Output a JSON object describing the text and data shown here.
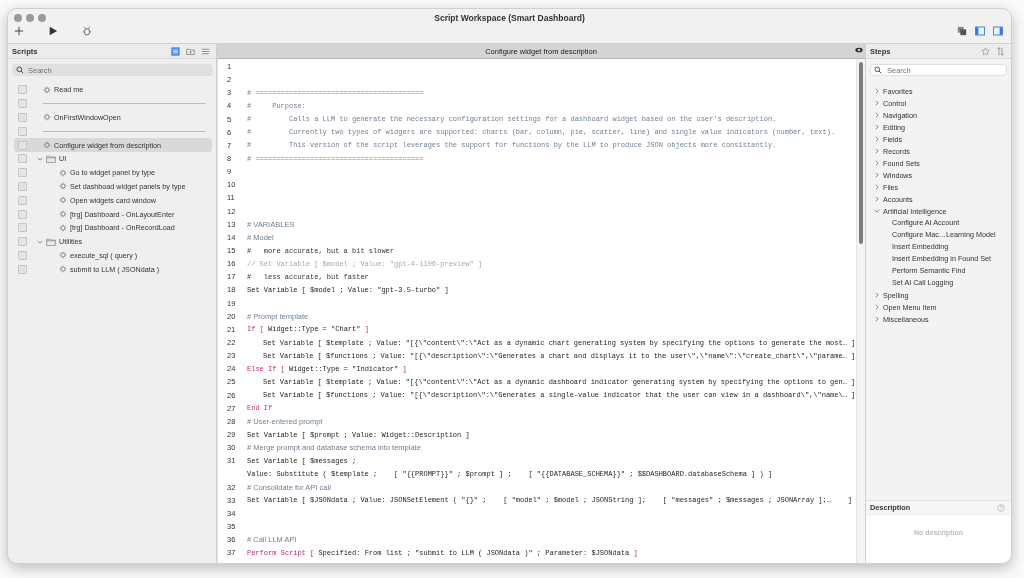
{
  "window": {
    "title": "Script Workspace (Smart Dashboard)"
  },
  "toolbar": {
    "left": [
      {
        "kind": "add"
      },
      {
        "kind": "run"
      },
      {
        "kind": "debug"
      }
    ],
    "right": [
      {
        "kind": "copies",
        "on": false
      },
      {
        "kind": "left-panel",
        "on": true
      },
      {
        "kind": "right-panel",
        "on": true
      }
    ]
  },
  "scripts": {
    "title": "Scripts",
    "view_buttons": [
      {
        "kind": "list",
        "selected": true
      },
      {
        "kind": "folder",
        "selected": false
      },
      {
        "kind": "lines",
        "selected": false
      }
    ],
    "search": {
      "placeholder": "Search"
    },
    "items": [
      {
        "kind": "script",
        "label": "Read me",
        "selected": false
      },
      {
        "kind": "separator",
        "selected": false
      },
      {
        "kind": "script",
        "label": "OnFirstWindowOpen",
        "selected": false
      },
      {
        "kind": "separator",
        "selected": false
      },
      {
        "kind": "script",
        "label": "Configure widget from description",
        "selected": true
      },
      {
        "kind": "folder",
        "label": "UI",
        "selected": false,
        "expanded": true,
        "children": [
          {
            "kind": "script",
            "label": "Go to widget panel by type",
            "selected": false
          },
          {
            "kind": "script",
            "label": "Set dashboad widget panels by type",
            "selected": false
          },
          {
            "kind": "script",
            "label": "Open widgets card window",
            "selected": false
          },
          {
            "kind": "script",
            "label": "[trg] Dashboard - OnLayoutEnter",
            "selected": false
          },
          {
            "kind": "script",
            "label": "[trg] Dashboard - OnRecordLoad",
            "selected": false
          }
        ]
      },
      {
        "kind": "folder",
        "label": "Utilities",
        "selected": false,
        "expanded": true,
        "children": [
          {
            "kind": "script",
            "label": "execute_sql ( query )",
            "selected": false
          },
          {
            "kind": "script",
            "label": "submit to LLM ( JSONdata )",
            "selected": false
          }
        ]
      }
    ]
  },
  "editor": {
    "title": "Configure widget from description",
    "lines": [
      {
        "number": "1"
      },
      {
        "number": "2"
      },
      {
        "number": "3",
        "rows": [
          [
            {
              "kind": "comment",
              "text": "# ========================================"
            }
          ]
        ]
      },
      {
        "number": "4",
        "rows": [
          [
            {
              "kind": "comment",
              "text": "#     Purpose:"
            }
          ]
        ]
      },
      {
        "number": "5",
        "rows": [
          [
            {
              "kind": "comment",
              "text": "#         Calls a LLM to generate the necessary configuration settings for a dashboard widget based on the user's description."
            }
          ]
        ]
      },
      {
        "number": "6",
        "rows": [
          [
            {
              "kind": "comment",
              "text": "#         Currently two types of widgers are supported: charts (bar, column, pie, scatter, line) and single value indicators (number, text)."
            }
          ]
        ]
      },
      {
        "number": "7",
        "rows": [
          [
            {
              "kind": "comment",
              "text": "#         This version of the script leverages the support for functions by the LLM to produce JSON objects more consistantly."
            }
          ]
        ]
      },
      {
        "number": "8",
        "rows": [
          [
            {
              "kind": "comment",
              "text": "# ========================================"
            }
          ]
        ]
      },
      {
        "number": "9"
      },
      {
        "number": "10"
      },
      {
        "number": "11"
      },
      {
        "number": "12"
      },
      {
        "number": "13",
        "rows": [
          [
            {
              "kind": "note",
              "text": "# VARIABLES"
            }
          ]
        ]
      },
      {
        "number": "14",
        "rows": [
          [
            {
              "kind": "note",
              "text": "# Model"
            }
          ]
        ]
      },
      {
        "number": "15",
        "rows": [
          [
            {
              "kind": "plain",
              "text": "#   more accurate, but a bit slower"
            }
          ]
        ]
      },
      {
        "number": "16",
        "rows": [
          [
            {
              "kind": "disabled",
              "text": "// Set Variable [ $model ; Value: \"gpt-4-1106-preview\" ]"
            }
          ]
        ]
      },
      {
        "number": "17",
        "rows": [
          [
            {
              "kind": "plain",
              "text": "#   less accurate, but faster"
            }
          ]
        ]
      },
      {
        "number": "18",
        "rows": [
          [
            {
              "kind": "step",
              "text": "Set Variable [ $model ; Value: \"gpt-3.5-turbo\" ]"
            }
          ]
        ]
      },
      {
        "number": "19"
      },
      {
        "number": "20",
        "rows": [
          [
            {
              "kind": "note",
              "text": "# Prompt template"
            }
          ]
        ]
      },
      {
        "number": "21",
        "rows": [
          [
            {
              "kind": "control",
              "text": "If [ "
            },
            {
              "kind": "step",
              "text": "Widget::Type = \"Chart\""
            },
            {
              "kind": "control",
              "text": " ]"
            }
          ]
        ],
        "children": [
          {
            "number": "22",
            "rows": [
              [
                {
                  "kind": "step",
                  "text": "Set Variable [ $template ; Value: \"[{\\\"content\\\":\\\"Act as a dynamic chart generating system by specifying the options to generate the most… ]"
                }
              ]
            ]
          },
          {
            "number": "23",
            "rows": [
              [
                {
                  "kind": "step",
                  "text": "Set Variable [ $functions ; Value: \"[{\\\"description\\\":\\\"Generates a chart and displays it to the user\\\",\\\"name\\\":\\\"create_chart\\\",\\\"parame… ]"
                }
              ]
            ]
          }
        ]
      },
      {
        "number": "24",
        "rows": [
          [
            {
              "kind": "control",
              "text": "Else If [ "
            },
            {
              "kind": "step",
              "text": "Widget::Type = \"Indicator\""
            },
            {
              "kind": "control",
              "text": " ]"
            }
          ]
        ],
        "children": [
          {
            "number": "25",
            "rows": [
              [
                {
                  "kind": "step",
                  "text": "Set Variable [ $template ; Value: \"[{\\\"content\\\":\\\"Act as a dynamic dashboard indicator generating system by specifying the options to gen… ]"
                }
              ]
            ]
          },
          {
            "number": "26",
            "rows": [
              [
                {
                  "kind": "step",
                  "text": "Set Variable [ $functions ; Value: \"[{\\\"description\\\":\\\"Generates a single-value indicator that the user can view in a dashboard\\\",\\\"name\\… ]"
                }
              ]
            ]
          }
        ]
      },
      {
        "number": "27",
        "rows": [
          [
            {
              "kind": "control",
              "text": "End If"
            }
          ]
        ]
      },
      {
        "number": "28",
        "rows": [
          [
            {
              "kind": "note",
              "text": "# User-entered prompt"
            }
          ]
        ]
      },
      {
        "number": "29",
        "rows": [
          [
            {
              "kind": "step",
              "text": "Set Variable [ $prompt ; Value: Widget::Description ]"
            }
          ]
        ]
      },
      {
        "number": "30",
        "rows": [
          [
            {
              "kind": "note",
              "text": "# Merge prompt and database schema into template"
            }
          ]
        ]
      },
      {
        "number": "31",
        "rows": [
          [
            {
              "kind": "step",
              "text": "Set Variable [ $messages ;"
            }
          ],
          [
            {
              "kind": "step",
              "text": "Value: Substitute ( $template ;    [ \"{{PROMPT}}\" ; $prompt ] ;    [ \"{{DATABASE_SCHEMA}}\" ; $$DASHBOARD.databaseSchema ] ) ]"
            }
          ]
        ]
      },
      {
        "number": "32",
        "rows": [
          [
            {
              "kind": "note",
              "text": "# Consolidate for API call"
            }
          ]
        ]
      },
      {
        "number": "33",
        "rows": [
          [
            {
              "kind": "step",
              "text": "Set Variable [ $JSONdata ; Value: JSONSetElement ( \"{}\" ;    [ \"model\" ; $model ; JSONString ];    [ \"messages\" ; $messages ; JSONArray ];…    ]"
            }
          ]
        ]
      },
      {
        "number": "34"
      },
      {
        "number": "35"
      },
      {
        "number": "36",
        "rows": [
          [
            {
              "kind": "note",
              "text": "# Call LLM API"
            }
          ]
        ]
      },
      {
        "number": "37",
        "rows": [
          [
            {
              "kind": "control",
              "text": "Perform Script [ "
            },
            {
              "kind": "step",
              "text": "Specified: From list ; \"submit to LLM ( JSONdata )\" ; Parameter: $JSONdata"
            },
            {
              "kind": "control",
              "text": " ]"
            }
          ]
        ]
      }
    ]
  },
  "steps": {
    "title": "Steps",
    "search": {
      "placeholder": "Search"
    },
    "categories": [
      {
        "label": "Favorites",
        "expanded": false
      },
      {
        "label": "Control",
        "expanded": false
      },
      {
        "label": "Navigation",
        "expanded": false
      },
      {
        "label": "Editing",
        "expanded": false
      },
      {
        "label": "Fields",
        "expanded": false
      },
      {
        "label": "Records",
        "expanded": false
      },
      {
        "label": "Found Sets",
        "expanded": false
      },
      {
        "label": "Windows",
        "expanded": false
      },
      {
        "label": "Files",
        "expanded": false
      },
      {
        "label": "Accounts",
        "expanded": false
      },
      {
        "label": "Artificial Intelligence",
        "expanded": true,
        "children": [
          "Configure AI Account",
          "Configure Mac…Learning Model",
          "Insert Embedding",
          "Insert Embedding in Found Set",
          "Perform Semantic Find",
          "Set AI Call Logging"
        ]
      },
      {
        "label": "Spelling",
        "expanded": false
      },
      {
        "label": "Open Menu Item",
        "expanded": false
      },
      {
        "label": "Miscellaneous",
        "expanded": false
      }
    ]
  },
  "description": {
    "title": "Description",
    "text": "No description"
  }
}
